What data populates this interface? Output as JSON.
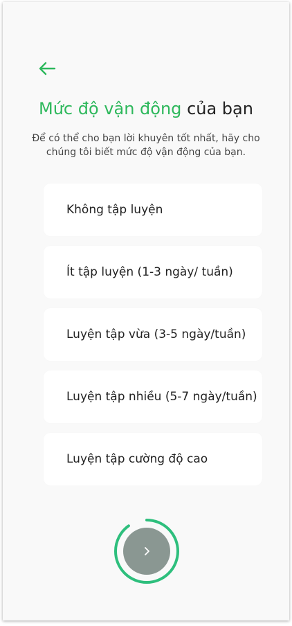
{
  "header": {
    "back_icon": "arrow-left-icon",
    "title_accent": "Mức độ vận động",
    "title_rest": "của bạn",
    "subtitle": "Để có thể cho bạn lời khuyên tốt nhất, hãy cho chúng tôi biết mức độ vận động của bạn."
  },
  "options": [
    {
      "label": "Không tập luyện"
    },
    {
      "label": "Ít tập luyện (1-3 ngày/ tuần)"
    },
    {
      "label": "Luyện tập vừa (3-5 ngày/tuần)"
    },
    {
      "label": "Luyện tập nhiều (5-7 ngày/tuần)"
    },
    {
      "label": "Luyện tập cường độ cao"
    }
  ],
  "next": {
    "icon": "chevron-right-icon",
    "progress_fraction": 0.9
  },
  "colors": {
    "accent": "#2eb85c",
    "ring": "#2ebf7d",
    "button": "#8a9792",
    "background": "#f9f9f9"
  }
}
